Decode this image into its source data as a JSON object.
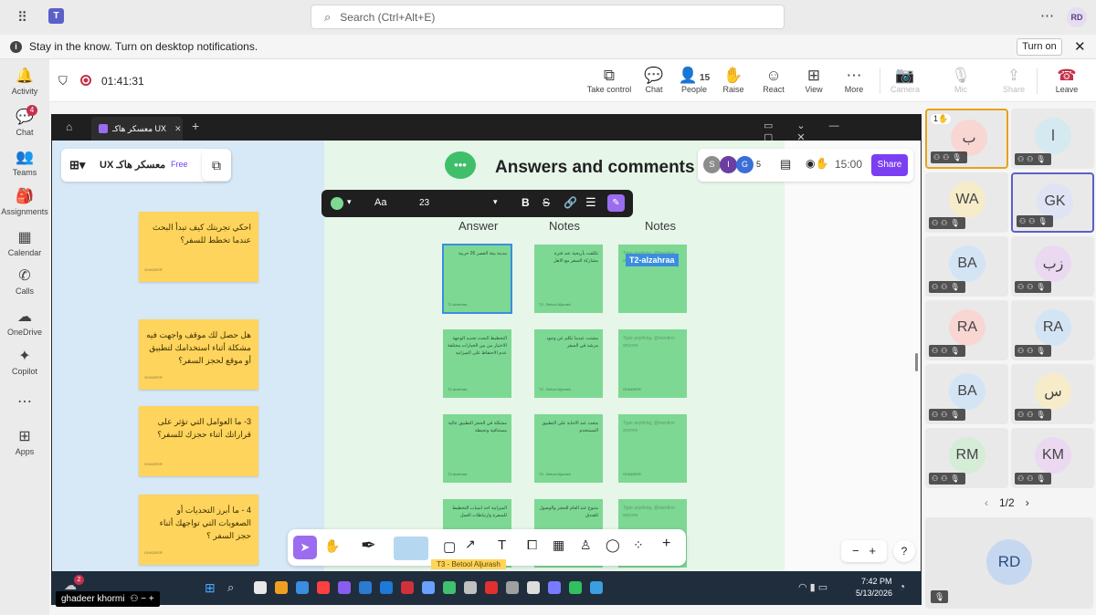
{
  "search": {
    "placeholder": "Search (Ctrl+Alt+E)"
  },
  "user": {
    "initials": "RD"
  },
  "notification": {
    "text": "Stay in the know. Turn on desktop notifications.",
    "button": "Turn on"
  },
  "rail": [
    {
      "label": "Activity",
      "icon": "bell-icon",
      "glyph": "🔔"
    },
    {
      "label": "Chat",
      "icon": "chat-icon",
      "glyph": "💬",
      "badge": "4"
    },
    {
      "label": "Teams",
      "icon": "teams-icon",
      "glyph": "👥"
    },
    {
      "label": "Assignments",
      "icon": "assignments-icon",
      "glyph": "🎒"
    },
    {
      "label": "Calendar",
      "icon": "calendar-icon",
      "glyph": "▦"
    },
    {
      "label": "Calls",
      "icon": "calls-icon",
      "glyph": "✆"
    },
    {
      "label": "OneDrive",
      "icon": "onedrive-icon",
      "glyph": "☁"
    },
    {
      "label": "Copilot",
      "icon": "copilot-icon",
      "glyph": "✦"
    },
    {
      "label": "",
      "icon": "more-icon",
      "glyph": "⋯"
    },
    {
      "label": "Apps",
      "icon": "apps-icon",
      "glyph": "⊞"
    }
  ],
  "meeting": {
    "timer": "01:41:31",
    "controls": [
      {
        "label": "Take control",
        "glyph": "⧉",
        "icon": "take-control-icon"
      },
      {
        "label": "Chat",
        "glyph": "💬",
        "icon": "chat-icon"
      },
      {
        "label": "People",
        "glyph": "👤",
        "icon": "people-icon",
        "count": "15"
      },
      {
        "label": "Raise",
        "glyph": "✋",
        "icon": "raise-hand-icon"
      },
      {
        "label": "React",
        "glyph": "☺",
        "icon": "react-icon"
      },
      {
        "label": "View",
        "glyph": "⊞",
        "icon": "view-icon"
      },
      {
        "label": "More",
        "glyph": "⋯",
        "icon": "more-icon"
      },
      {
        "label": "Camera",
        "glyph": "📷",
        "icon": "camera-icon",
        "disabled": true
      },
      {
        "label": "Mic",
        "glyph": "🎙",
        "icon": "mic-icon",
        "disabled": true
      },
      {
        "label": "Share",
        "glyph": "⇪",
        "icon": "share-icon",
        "disabled": true
      },
      {
        "label": "Leave",
        "glyph": "☎",
        "icon": "leave-icon"
      }
    ]
  },
  "miro": {
    "tab_title": "معسكر هاكـ UX",
    "board_name": "معسكر هاكـ UX",
    "plan_badge": "Free",
    "heading": "Answers and comments",
    "columns": [
      "Answer",
      "Notes",
      "Notes"
    ],
    "collab_avatars": [
      "S",
      "I",
      "G"
    ],
    "collab_count": "5",
    "timer": "15:00",
    "share": "Share",
    "font_size": "23",
    "font_label": "Aa",
    "cursor_label": "T2-alzahraa",
    "bottom_label": "T3 - Betool Aljurash",
    "zoom_help": "?"
  },
  "questions": [
    "احكي تجربتك كيف تبدأ البحث عندما تخطط للسفر؟",
    "هل حصل لك موقف واجهت فيه مشكلة أثناء استخدامك لتطبيق أو موقع لحجز السفر؟",
    "3- ما العوامل التي تؤثر على قراراتك أثناء حجزك للسفر؟",
    "4 - ما أبرز التحديات أو الصعوبات التي تواجهك أثناء حجز السفر ؟"
  ],
  "notes": [
    {
      "text": "مدينة بيئة الفصر 26 حربية",
      "author": "T2-alzahraa"
    },
    {
      "text": "تكلفت بأريحية عند فترة مشاركة السفر مع الاهل",
      "author": "T3 - Betool Aljurash"
    },
    {
      "text": "Type anything, @mention anyone",
      "author": "",
      "placeholder": true
    },
    {
      "text": "التخطيط البحث تحديد الوجهة الاختيار من بين الخيارات مختلفة عدم الاحتفاظ على الميزانيه",
      "author": "T2-alzahraa"
    },
    {
      "text": "مشتت عندما تكلم عن وجود مرشد في السفر",
      "author": "T3 - Betool Aljurash"
    },
    {
      "text": "Type anything, @mention anyone",
      "author": "GHADEER",
      "placeholder": true
    },
    {
      "text": "مشكلة في الحجز التطبيق عالية مستنافية وتحيطة",
      "author": "T2-alzahraa"
    },
    {
      "text": "متعدد عند الاجابة على التطبيق المستخدم",
      "author": "T3 - Betool Aljurash"
    },
    {
      "text": "Type anything, @mention anyone",
      "author": "GHADEER",
      "placeholder": true
    },
    {
      "text": "الميزانية احد اسباب التخطيط للسفرة وارتباطات العمل",
      "author": "T2-alzahraa"
    },
    {
      "text": "متنوع عند العام للحجز والوصول للفندق",
      "author": "T3 - Betool Aljurash"
    },
    {
      "text": "Type anything, @mention anyone",
      "author": "",
      "placeholder": true
    }
  ],
  "sticky_author": "GHADEER",
  "taskbar": {
    "user": "ghadeer khormi",
    "badge": "2",
    "time": "7:42 PM",
    "date": "5/13/2026"
  },
  "participants": [
    {
      "initials": "ب",
      "bg": "#f8d6d2",
      "hand": "1"
    },
    {
      "initials": "ا",
      "bg": "#d5e9f0"
    },
    {
      "initials": "WA",
      "bg": "#f7ecc9"
    },
    {
      "initials": "GK",
      "bg": "#dfe3f3"
    },
    {
      "initials": "BA",
      "bg": "#d3e4f5"
    },
    {
      "initials": "زب",
      "bg": "#ead9f0"
    },
    {
      "initials": "RA",
      "bg": "#f8d6d2"
    },
    {
      "initials": "RA",
      "bg": "#d3e4f5"
    },
    {
      "initials": "BA",
      "bg": "#d3e4f5"
    },
    {
      "initials": "س",
      "bg": "#f7ecc9"
    },
    {
      "initials": "RM",
      "bg": "#d5ecd7"
    },
    {
      "initials": "KM",
      "bg": "#ead9f0"
    }
  ],
  "pager": "1/2",
  "self_tile": {
    "initials": "RD"
  }
}
